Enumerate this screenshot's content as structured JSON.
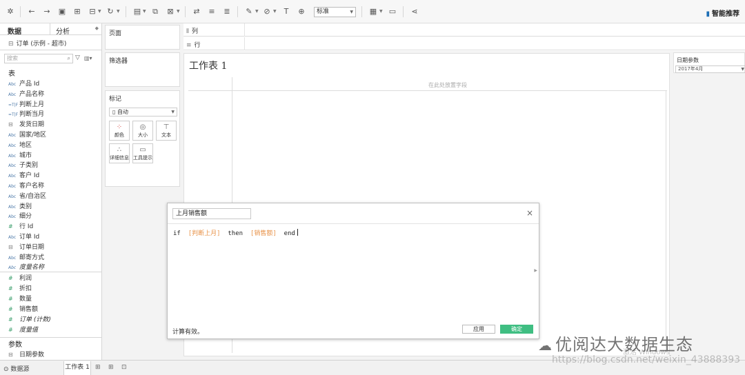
{
  "toolbar": {
    "fit_select": "标准",
    "smart_label": "智能推荐"
  },
  "data_pane": {
    "tabs": [
      "数据",
      "分析"
    ],
    "datasource": "订单 (示例 - 超市)",
    "search_placeholder": "搜索",
    "tables_header": "表",
    "dimensions": [
      {
        "type": "Abc",
        "name": "产品 Id"
      },
      {
        "type": "Abc",
        "name": "产品名称"
      },
      {
        "type": "T|F",
        "name": "判断上月"
      },
      {
        "type": "T|F",
        "name": "判断当月"
      },
      {
        "type": "date",
        "name": "发货日期"
      },
      {
        "type": "Abc",
        "name": "国家/地区"
      },
      {
        "type": "Abc",
        "name": "地区"
      },
      {
        "type": "Abc",
        "name": "城市"
      },
      {
        "type": "Abc",
        "name": "子类别"
      },
      {
        "type": "Abc",
        "name": "客户 Id"
      },
      {
        "type": "Abc",
        "name": "客户名称"
      },
      {
        "type": "Abc",
        "name": "省/自治区"
      },
      {
        "type": "Abc",
        "name": "类别"
      },
      {
        "type": "Abc",
        "name": "细分"
      },
      {
        "type": "#",
        "name": "行 Id"
      },
      {
        "type": "Abc",
        "name": "订单 Id"
      },
      {
        "type": "date",
        "name": "订单日期"
      },
      {
        "type": "Abc",
        "name": "邮寄方式"
      },
      {
        "type": "Abc",
        "name": "度量名称",
        "italic": true
      }
    ],
    "measures": [
      {
        "type": "#",
        "name": "利润"
      },
      {
        "type": "#",
        "name": "折扣"
      },
      {
        "type": "#",
        "name": "数量"
      },
      {
        "type": "#",
        "name": "销售额"
      },
      {
        "type": "#",
        "name": "订单 (计数)",
        "italic": true
      },
      {
        "type": "#",
        "name": "度量值",
        "italic": true
      }
    ],
    "params_header": "参数",
    "params": [
      {
        "type": "date",
        "name": "日期参数"
      }
    ]
  },
  "shelves": {
    "pages": "页面",
    "filters": "筛选器",
    "marks": "标记",
    "marks_type": "自动",
    "mark_buttons": [
      "颜色",
      "大小",
      "文本",
      "详细信息",
      "工具提示"
    ],
    "columns": "列",
    "rows": "行"
  },
  "sheet": {
    "title": "工作表 1",
    "drop_hint": "在此处放置字段"
  },
  "param_card": {
    "title": "日期参数",
    "value": "2017年4月"
  },
  "calc_dialog": {
    "name": "上月销售额",
    "formula": {
      "kw_if": "if",
      "field1": "[判断上月]",
      "kw_then": "then",
      "field2": "[销售额]",
      "kw_end": "end"
    },
    "status": "计算有效。",
    "apply": "应用",
    "ok": "确定",
    "close": "×"
  },
  "bottom_tabs": {
    "datasource": "数据源",
    "sheet": "工作表 1"
  },
  "watermark": {
    "brand": "优阅达大数据生态",
    "url": "https://blog.csdn.net/weixin_43888393",
    "activate": "激活 Windows"
  },
  "colors": {
    "ok_button": "#3fbe82",
    "field_ref": "#e8934a",
    "dimension_type": "#4b78a8",
    "measure_type": "#3a9e6b"
  }
}
